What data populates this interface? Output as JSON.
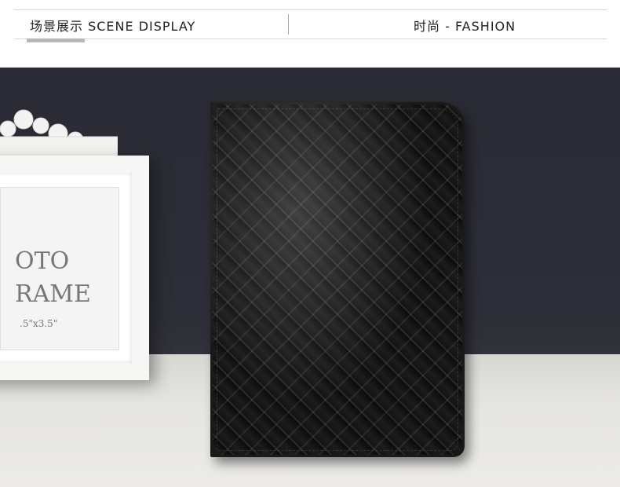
{
  "header": {
    "left_label": "场景展示 SCENE DISPLAY",
    "right_label": "时尚 - FASHION"
  },
  "scene": {
    "frame_text_line1": "OTO",
    "frame_text_line2": "RAME",
    "frame_text_size": ".5\"x3.5\""
  },
  "colors": {
    "background_dark": "#2e2e38",
    "table_surface": "#e6e5e1",
    "wallet": "#111111",
    "accent_bar": "#b8b8b8"
  }
}
